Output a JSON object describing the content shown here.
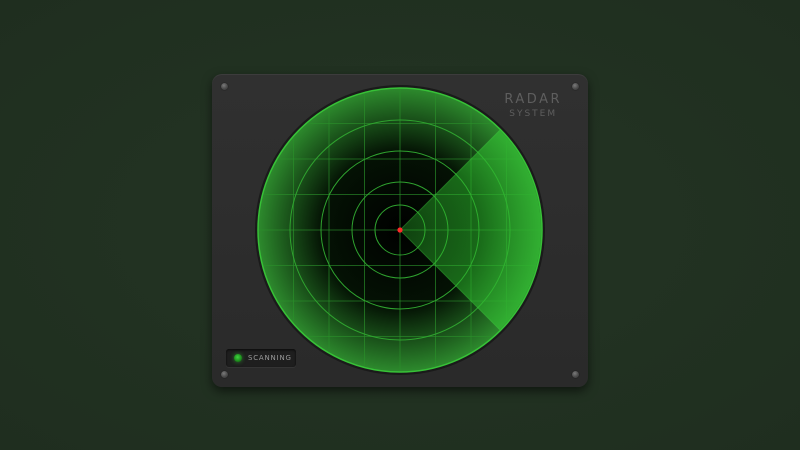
{
  "brand": {
    "title": "RADAR",
    "subtitle": "SYSTEM"
  },
  "status": {
    "label": "SCANNING",
    "led_color": "#2fbf2f"
  },
  "radar": {
    "ring_count": 4,
    "grid_divisions": 8,
    "sweep_angle_deg": 90,
    "sweep_direction": "right",
    "center_blip_color": "#ff2a2a",
    "accent_color": "#2ecc2e"
  },
  "icons": {
    "screws": [
      "screw-icon",
      "screw-icon",
      "screw-icon",
      "screw-icon"
    ],
    "status_led": "led-indicator-icon"
  }
}
